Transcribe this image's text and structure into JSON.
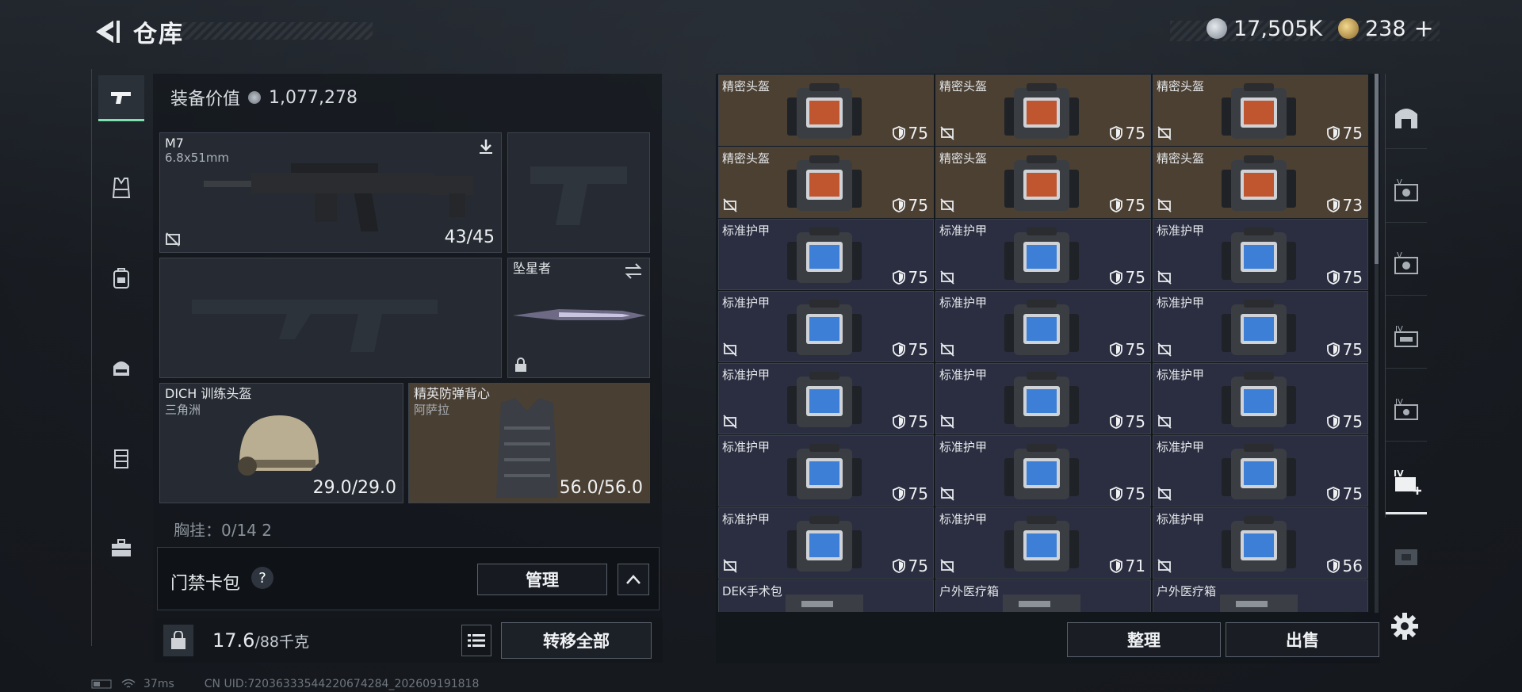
{
  "header": {
    "title": "仓库",
    "currency_silver": "17,505K",
    "currency_gold": "238",
    "plus_label": "+"
  },
  "left_rail": [
    "pistol-icon",
    "vest-icon",
    "backpack-icon",
    "chest-rig-icon",
    "container-icon",
    "toolbox-icon"
  ],
  "equipment": {
    "value_label": "装备价值",
    "value": "1,077,278",
    "primary_weapon": {
      "name": "M7",
      "caliber": "6.8x51mm",
      "ammo": "43/45"
    },
    "melee": {
      "name": "坠星者"
    },
    "helmet": {
      "name": "DICH 训练头盔",
      "sub": "三角洲",
      "durability": "29.0/29.0"
    },
    "armor": {
      "name": "精英防弹背心",
      "sub": "阿萨拉",
      "durability": "56.0/56.0"
    },
    "pouch_label": "胸挂：0/14   2"
  },
  "keycard": {
    "label": "门禁卡包",
    "help": "?",
    "manage": "管理"
  },
  "capacity": {
    "weight": "17.6",
    "max": "/88千克",
    "transfer_all": "转移全部"
  },
  "storage": {
    "sort_label": "整理",
    "sell_label": "出售",
    "items": [
      {
        "name": "精密头盔",
        "value": "75",
        "type": "helmet",
        "nobind": false
      },
      {
        "name": "精密头盔",
        "value": "75",
        "type": "helmet",
        "nobind": true
      },
      {
        "name": "精密头盔",
        "value": "75",
        "type": "helmet",
        "nobind": true
      },
      {
        "name": "精密头盔",
        "value": "75",
        "type": "helmet",
        "nobind": true
      },
      {
        "name": "精密头盔",
        "value": "75",
        "type": "helmet",
        "nobind": true
      },
      {
        "name": "精密头盔",
        "value": "73",
        "type": "helmet",
        "nobind": true
      },
      {
        "name": "标准护甲",
        "value": "75",
        "type": "armor",
        "nobind": false
      },
      {
        "name": "标准护甲",
        "value": "75",
        "type": "armor",
        "nobind": true
      },
      {
        "name": "标准护甲",
        "value": "75",
        "type": "armor",
        "nobind": true
      },
      {
        "name": "标准护甲",
        "value": "75",
        "type": "armor",
        "nobind": true
      },
      {
        "name": "标准护甲",
        "value": "75",
        "type": "armor",
        "nobind": true
      },
      {
        "name": "标准护甲",
        "value": "75",
        "type": "armor",
        "nobind": true
      },
      {
        "name": "标准护甲",
        "value": "75",
        "type": "armor",
        "nobind": true
      },
      {
        "name": "标准护甲",
        "value": "75",
        "type": "armor",
        "nobind": true
      },
      {
        "name": "标准护甲",
        "value": "75",
        "type": "armor",
        "nobind": true
      },
      {
        "name": "标准护甲",
        "value": "75",
        "type": "armor",
        "nobind": false
      },
      {
        "name": "标准护甲",
        "value": "75",
        "type": "armor",
        "nobind": true
      },
      {
        "name": "标准护甲",
        "value": "75",
        "type": "armor",
        "nobind": true
      },
      {
        "name": "标准护甲",
        "value": "75",
        "type": "armor",
        "nobind": true
      },
      {
        "name": "标准护甲",
        "value": "71",
        "type": "armor",
        "nobind": true
      },
      {
        "name": "标准护甲",
        "value": "56",
        "type": "armor",
        "nobind": true
      },
      {
        "name": "DEK手术包",
        "value": "",
        "type": "med",
        "nobind": false
      },
      {
        "name": "户外医疗箱",
        "value": "",
        "type": "med",
        "nobind": false
      },
      {
        "name": "户外医疗箱",
        "value": "",
        "type": "med",
        "nobind": false
      }
    ]
  },
  "right_rail": [
    "shop-icon",
    "case-v1-icon",
    "case-v2-icon",
    "case-iv1-icon",
    "case-iv2-icon",
    "case-iv-add-icon",
    "case-locked-icon"
  ],
  "status": {
    "ping": "37ms",
    "uid": "CN UID:72036333544220674284_202609191818"
  },
  "colors": {
    "accent": "#7fe0b0",
    "helmet_bg": "#4c4033",
    "armor_bg": "#2b2e40"
  }
}
